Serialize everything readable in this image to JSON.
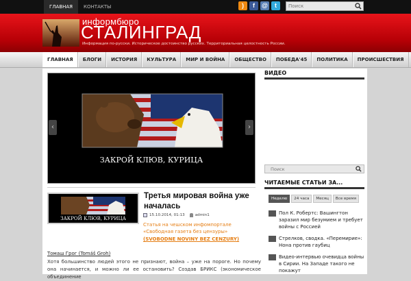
{
  "top_nav": {
    "home": "ГЛАВНАЯ",
    "contacts": "КОНТАКТЫ"
  },
  "top_search": {
    "placeholder": "Поиск"
  },
  "social_icons": [
    "rss-icon",
    "facebook-icon",
    "email-icon",
    "twitter-icon"
  ],
  "logo": {
    "small": "информбюро",
    "big": "СТАЛИНГРАД",
    "tagline": "Информация по-русски. Историческое достоинство русских. Территориальная целостность России."
  },
  "main_nav": [
    "ГЛАВНАЯ",
    "БЛОГИ",
    "ИСТОРИЯ",
    "КУЛЬТУРА",
    "МИР И ВОЙНА",
    "ОБЩЕСТВО",
    "ПОБЕДА'45",
    "ПОЛИТИКА",
    "ПРОИСШЕСТВИЯ"
  ],
  "slider": {
    "caption": "ЗАКРОЙ КЛЮВ, КУРИЦА",
    "prev": "‹",
    "next": "›"
  },
  "post": {
    "thumb_caption": "ЗАКРОЙ КЛЮВ, КУРИЦА",
    "title": "Третья мировая война уже началась",
    "date": "15.10.2014, 01:13",
    "author": "admin1",
    "excerpt": "Статья на чешском инфомпортале «Свободная газета без цензуры»",
    "source_link": "(SVOBODNE NOVINY BEZ CENZURY)",
    "byline": "Томаш Грог (Tomáš Groh)",
    "body": "Хотя большинство людей этого не признают, война – уже на пороге. Но почему она начинается, и можно ли ее остановить? Создав БРИКС (экономическое объединение"
  },
  "sidebar": {
    "video_title": "ВИДЕО",
    "search_placeholder": "Поиск",
    "popular_title": "ЧИТАЕМЫЕ СТАТЬИ ЗА...",
    "tabs": [
      "Неделю",
      "24 часа",
      "Месяц",
      "Все время"
    ],
    "items": [
      "Пол К. Робертс: Вашингтон заразил мир безумием и требует войны с Россией",
      "Стрелков, сводка. «Перемирие»: Нона против гаубиц",
      "Видео-интервью очевидца войны в Сирии. На Западе такого не покажут"
    ]
  },
  "colors": {
    "header_red": "#c8050b",
    "accent_orange": "#e57d12",
    "top_bar": "#111111"
  }
}
